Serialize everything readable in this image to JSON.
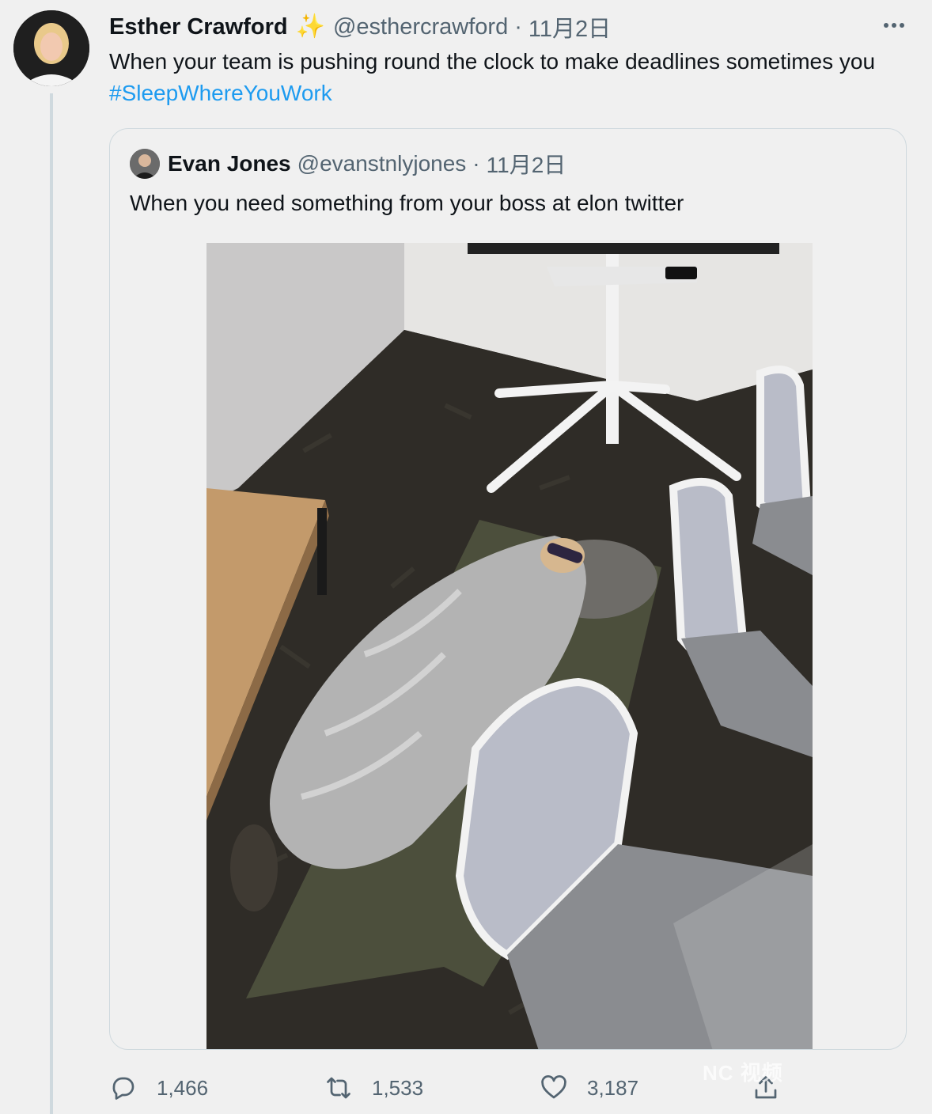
{
  "tweet": {
    "author_name": "Esther Crawford",
    "author_badge_icon": "sparkles-icon",
    "handle": "@esthercrawford",
    "separator": "·",
    "date": "11月2日",
    "text_plain": "When your team is pushing round the clock to make deadlines sometimes you ",
    "hashtag": "#SleepWhereYouWork"
  },
  "quoted": {
    "author_name": "Evan Jones",
    "handle": "@evanstnlyjones",
    "separator": "·",
    "date": "11月2日",
    "text": "When you need something from your boss at elon twitter"
  },
  "actions": {
    "replies": "1,466",
    "retweets": "1,533",
    "likes": "3,187"
  },
  "watermark": "NC 视频",
  "colors": {
    "link": "#1d9bf0",
    "secondary": "#536471",
    "background": "#f0f0f0"
  }
}
